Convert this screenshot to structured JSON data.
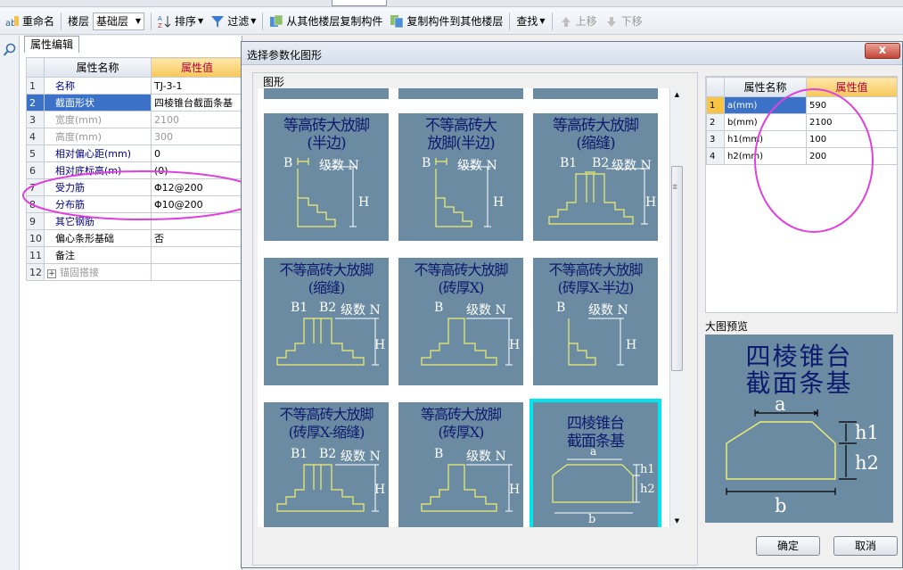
{
  "toolbar": {
    "rename": "重命名",
    "floor_label": "楼层",
    "floor_value": "基础层",
    "sort": "排序",
    "filter": "过滤",
    "copy_from": "从其他楼层复制构件",
    "copy_to": "复制构件到其他楼层",
    "find": "查找",
    "move_up": "上移",
    "move_down": "下移"
  },
  "left_panel": {
    "tab": "属性编辑",
    "header_name": "属性名称",
    "header_value": "属性值",
    "rows": [
      {
        "num": "1",
        "name": "名称",
        "value": "TJ-3-1"
      },
      {
        "num": "2",
        "name": "截面形状",
        "value": "四棱锥台截面条基"
      },
      {
        "num": "3",
        "name": "宽度(mm)",
        "value": "2100"
      },
      {
        "num": "4",
        "name": "高度(mm)",
        "value": "300"
      },
      {
        "num": "5",
        "name": "相对偏心距(mm)",
        "value": "0"
      },
      {
        "num": "6",
        "name": "相对底标高(m)",
        "value": "(0)"
      },
      {
        "num": "7",
        "name": "受力筋",
        "value": "Φ12@200"
      },
      {
        "num": "8",
        "name": "分布筋",
        "value": "Φ10@200"
      },
      {
        "num": "9",
        "name": "其它钢筋",
        "value": ""
      },
      {
        "num": "10",
        "name": "偏心条形基础",
        "value": "否"
      },
      {
        "num": "11",
        "name": "备注",
        "value": ""
      },
      {
        "num": "12",
        "name": "锚固搭接",
        "value": ""
      }
    ]
  },
  "dialog": {
    "title": "选择参数化图形",
    "close": "x",
    "shapes_label": "图形",
    "tiles": [
      {
        "caption": "等高砖大放脚\n(半边)",
        "b": "B",
        "n": "级数 N",
        "h": "H"
      },
      {
        "caption": "不等高砖大\n放脚(半边)",
        "b": "B",
        "n": "级数 N",
        "h": "H"
      },
      {
        "caption": "等高砖大放脚\n(缩缝)",
        "b": "B1",
        "b2": "B2",
        "n": "级数 N",
        "h": "H"
      },
      {
        "caption": "不等高砖大放脚\n(缩缝)",
        "b": "B1",
        "b2": "B2",
        "n": "级数 N",
        "h": "H"
      },
      {
        "caption": "不等高砖大放脚\n(砖厚X)",
        "b": "B",
        "n": "级数 N",
        "h": "H"
      },
      {
        "caption": "不等高砖大放脚\n(砖厚X-半边)",
        "b": "B",
        "n": "级数 N",
        "h": "H"
      },
      {
        "caption": "不等高砖大放脚\n(砖厚X-缩缝)",
        "b": "B1",
        "b2": "B2",
        "n": "级数 N",
        "h": "H"
      },
      {
        "caption": "等高砖大放脚\n(砖厚X)",
        "b": "B",
        "n": "级数 N",
        "h": "H"
      },
      {
        "caption": "四棱锥台\n截面条基",
        "a": "a",
        "h1": "h1",
        "h2": "h2",
        "bb": "b"
      }
    ],
    "param_header_name": "属性名称",
    "param_header_value": "属性值",
    "params": [
      {
        "num": "1",
        "name": "a(mm)",
        "value": "590"
      },
      {
        "num": "2",
        "name": "b(mm)",
        "value": "2100"
      },
      {
        "num": "3",
        "name": "h1(mm)",
        "value": "100"
      },
      {
        "num": "4",
        "name": "h2(mm)",
        "value": "200"
      }
    ],
    "preview_label": "大图预览",
    "preview": {
      "caption1": "四棱锥台",
      "caption2": "截面条基",
      "a": "a",
      "h1": "h1",
      "h2": "h2",
      "b": "b"
    },
    "ok": "确定",
    "cancel": "取消"
  },
  "colors": {
    "accent": "#3b72c7",
    "annotation": "#e040e0",
    "tile_bg": "#6b8ba3",
    "tile_caption": "#0c1a6e",
    "tile_line": "#f0f070"
  }
}
